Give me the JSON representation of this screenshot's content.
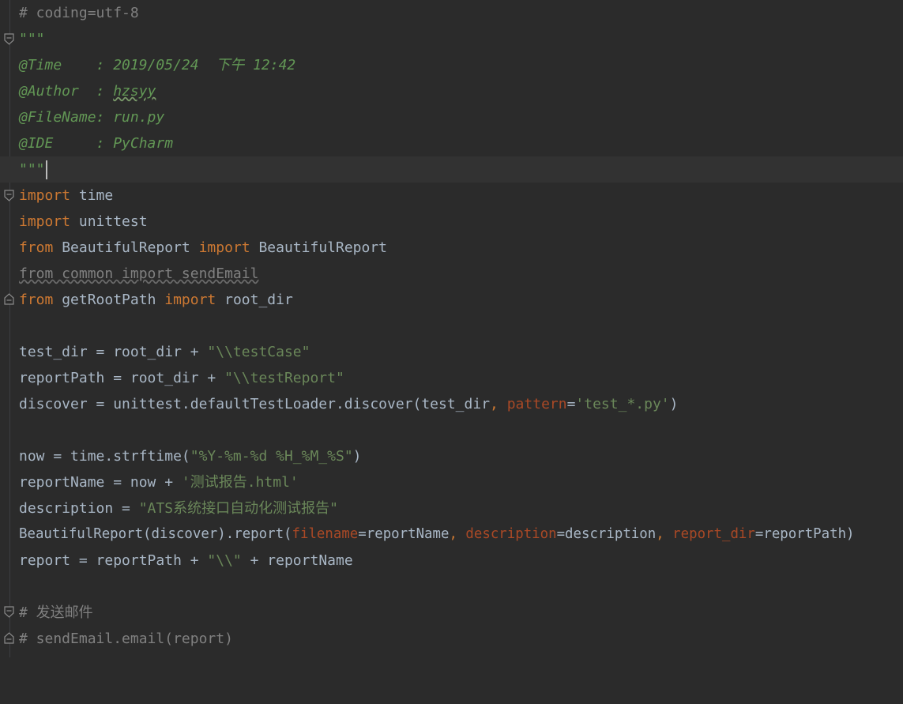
{
  "editor": {
    "language": "python",
    "colors": {
      "background": "#2b2b2b",
      "current_line": "#323232",
      "keyword": "#cc7832",
      "string": "#6a8759",
      "comment": "#808080",
      "docstring": "#629755",
      "parameter": "#aa4926",
      "plain": "#a9b7c6"
    },
    "lines": {
      "l1": {
        "t1": "# coding=utf-8"
      },
      "l2": {
        "t1": "\"\"\""
      },
      "l3": {
        "t1": "@Time    : 2019/05/24  下午 12:42"
      },
      "l4": {
        "t1": "@Author  : ",
        "t2": "hzsyy"
      },
      "l5": {
        "t1": "@FileName: run.py"
      },
      "l6": {
        "t1": "@IDE     : PyCharm"
      },
      "l7": {
        "t1": "\"\"\""
      },
      "l8": {
        "t1": "import",
        "t2": " time"
      },
      "l9": {
        "t1": "import",
        "t2": " unittest"
      },
      "l10": {
        "t1": "from",
        "t2": " BeautifulReport ",
        "t3": "import",
        "t4": " BeautifulReport"
      },
      "l11": {
        "t1": "from common import sendEmail"
      },
      "l12": {
        "t1": "from",
        "t2": " getRootPath ",
        "t3": "import",
        "t4": " root_dir"
      },
      "l14": {
        "t1": "test_dir = root_dir + ",
        "t2": "\"\\\\testCase\""
      },
      "l15": {
        "t1": "reportPath = root_dir + ",
        "t2": "\"\\\\testReport\""
      },
      "l16": {
        "t1": "discover = unittest.defaultTestLoader.discover(test_dir",
        "t2": ", ",
        "t3": "pattern",
        "t4": "=",
        "t5": "'test_*.py'",
        "t6": ")"
      },
      "l18": {
        "t1": "now = time.strftime(",
        "t2": "\"%Y-%m-%d %H_%M_%S\"",
        "t3": ")"
      },
      "l19": {
        "t1": "reportName = now + ",
        "t2": "'测试报告.html'"
      },
      "l20": {
        "t1": "description = ",
        "t2": "\"ATS系统接口自动化测试报告\""
      },
      "l21": {
        "t1": "BeautifulReport(discover).report(",
        "t2": "filename",
        "t3": "=reportName",
        "t4": ", ",
        "t5": "description",
        "t6": "=description",
        "t7": ", ",
        "t8": "report_dir",
        "t9": "=reportPath)"
      },
      "l22": {
        "t1": "report = reportPath + ",
        "t2": "\"\\\\\"",
        "t3": " + reportName"
      },
      "l24": {
        "t1": "# 发送邮件"
      },
      "l25": {
        "t1": "# sendEmail.email(report)"
      }
    },
    "fold_icons": [
      "fold-open-icon",
      "fold-close-icon"
    ]
  }
}
